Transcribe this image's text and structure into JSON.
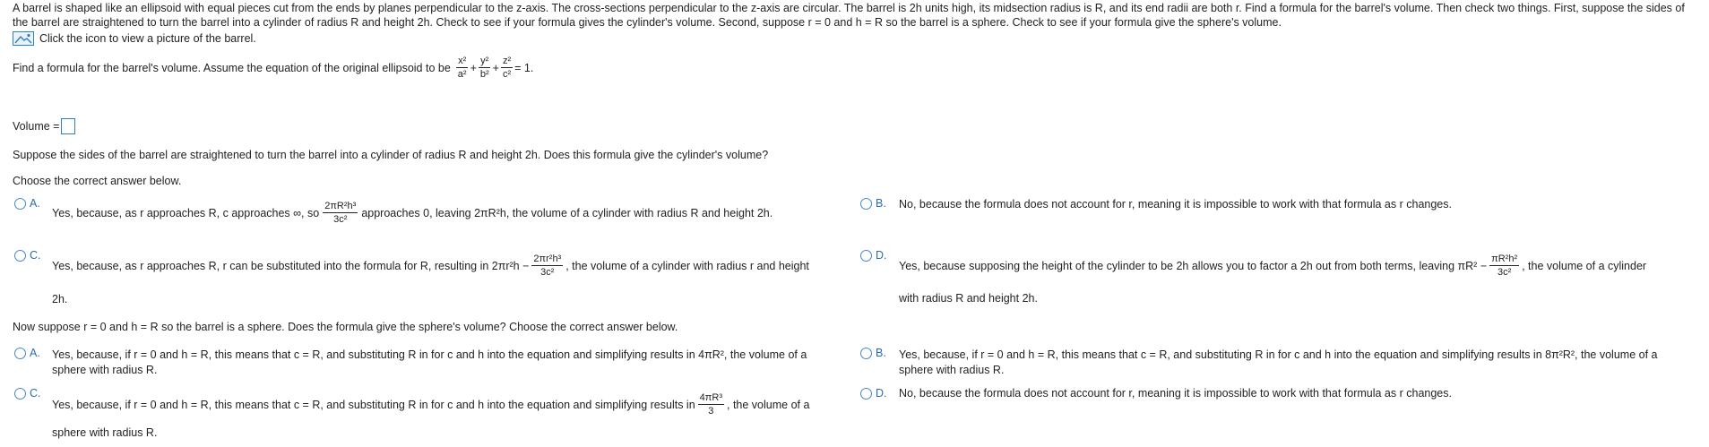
{
  "problem": {
    "text": "A barrel is shaped like an ellipsoid with equal pieces cut from the ends by planes perpendicular to the z-axis. The cross-sections perpendicular to the z-axis are circular. The barrel is 2h units high, its midsection radius is R, and its end radii are both r. Find a formula for the barrel's volume. Then check two things. First, suppose the sides of the barrel are straightened to turn the barrel into a cylinder of radius R and height 2h. Check to see if your formula gives the cylinder's volume. Second, suppose r = 0 and h = R so the barrel is a sphere. Check to see if your formula give the sphere's volume.",
    "picture_link": "Click the icon to view a picture of the barrel.",
    "picture_icon": "image-icon"
  },
  "part1": {
    "prompt": "Find a formula for the barrel's volume. Assume the equation of the original ellipsoid to be",
    "eq": {
      "t1": {
        "num": "x²",
        "den": "a²"
      },
      "plus1": "+",
      "t2": {
        "num": "y²",
        "den": "b²"
      },
      "plus2": "+",
      "t3": {
        "num": "z²",
        "den": "c²"
      },
      "rhs": "= 1."
    },
    "volume_label": "Volume ="
  },
  "part2": {
    "question": "Suppose the sides of the barrel are straightened to turn the barrel into a cylinder of radius R and height 2h. Does this formula give the cylinder's volume?",
    "instruction": "Choose the correct answer below.",
    "A": {
      "letter": "A.",
      "pre": "Yes, because, as r approaches R, c approaches ∞, so",
      "frac": {
        "num": "2πR²h³",
        "den": "3c²"
      },
      "post": "approaches 0, leaving 2πR²h, the volume of a cylinder with radius R and height 2h."
    },
    "B": {
      "letter": "B.",
      "text": "No, because the formula does not account for r, meaning it is impossible to work with that formula as r changes."
    },
    "C": {
      "letter": "C.",
      "pre": "Yes, because, as  r approaches R, r can be substituted into the formula for R, resulting in 2πr²h −",
      "frac": {
        "num": "2πr²h³",
        "den": "3c²"
      },
      "post": ", the volume of a cylinder with radius r and height",
      "line2": "2h."
    },
    "D": {
      "letter": "D.",
      "pre": "Yes, because supposing the height of the cylinder to be 2h allows you to factor a 2h out from both terms, leaving πR² −",
      "frac": {
        "num": "πR²h²",
        "den": "3c²"
      },
      "post": ", the volume of a cylinder",
      "line2": "with radius R and height 2h."
    }
  },
  "part3": {
    "question": "Now suppose r = 0 and h = R so the barrel is a sphere. Does the formula give the sphere's volume? Choose the correct answer below.",
    "A": {
      "letter": "A.",
      "line1": "Yes, because, if r = 0 and h = R, this means that c = R, and substituting R in for c and h into the equation and simplifying results in 4πR², the volume of a",
      "line2": "sphere with radius R."
    },
    "B": {
      "letter": "B.",
      "line1": "Yes, because, if r = 0 and h = R, this means that c = R, and substituting R in for c and h into the equation and simplifying results in 8π²R², the volume of a",
      "line2": "sphere with radius R."
    },
    "C": {
      "letter": "C.",
      "pre": "Yes, because, if r = 0 and h = R, this means that c = R, and substituting R in for c and h into the equation and simplifying results in",
      "frac": {
        "num": "4πR³",
        "den": "3"
      },
      "post": ", the volume of a",
      "line2": "sphere with radius R."
    },
    "D": {
      "letter": "D.",
      "text": "No, because the formula does not account for r, meaning it is impossible to work with that formula as r changes."
    }
  },
  "colors": {
    "accent": "#2b6cb0",
    "radio_border": "#4a86c5",
    "text": "#222222"
  }
}
